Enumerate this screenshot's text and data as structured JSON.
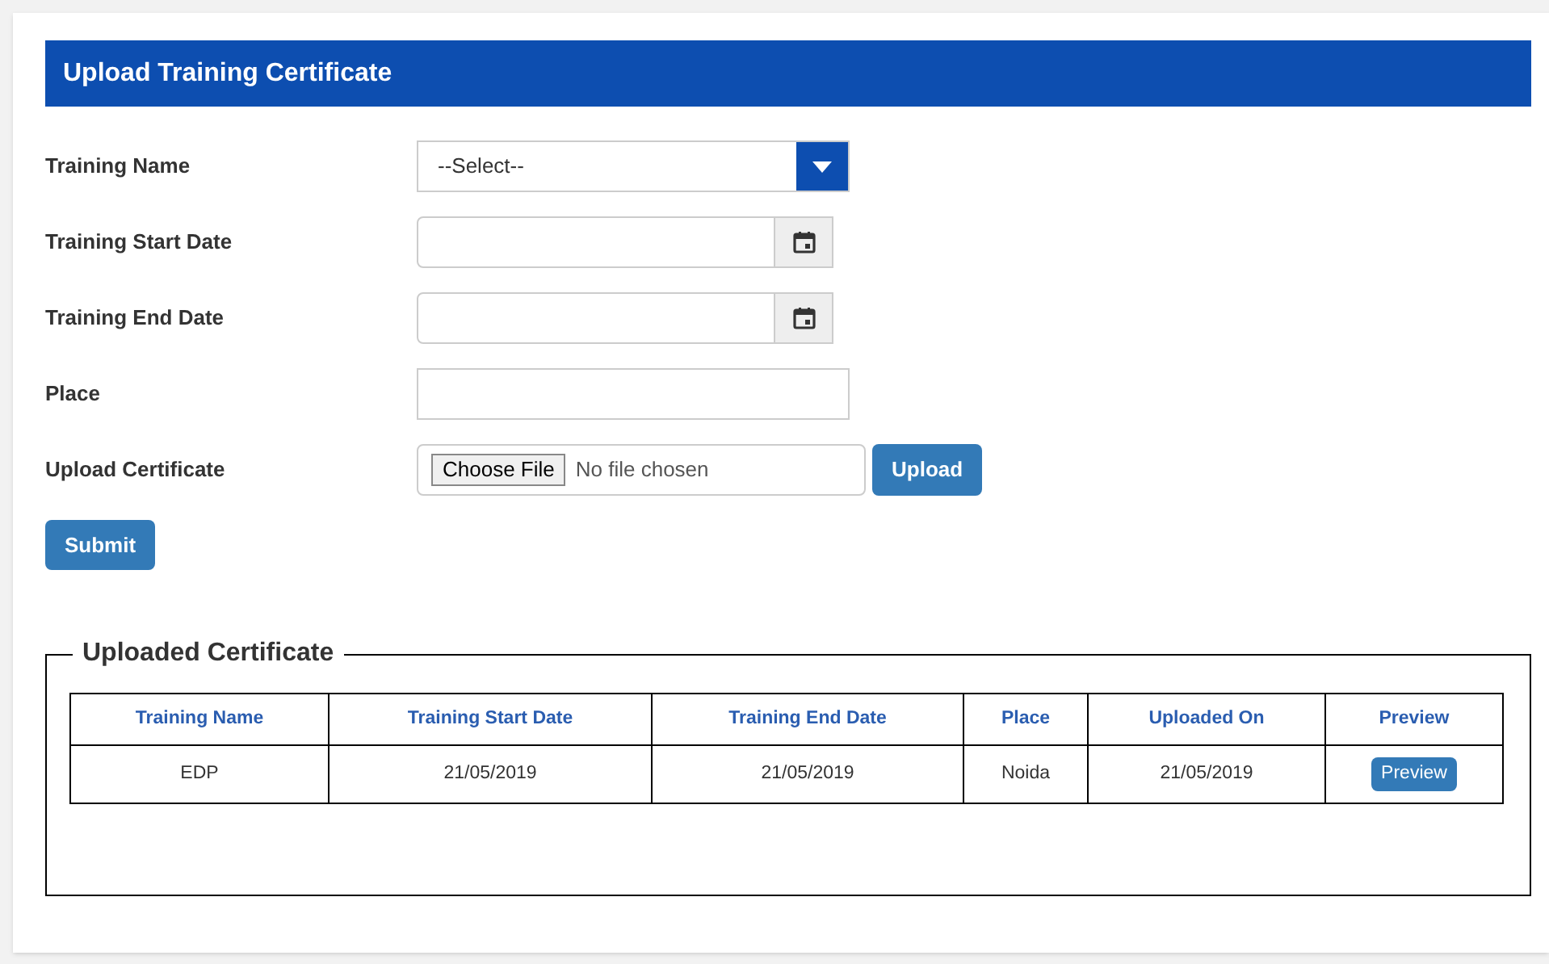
{
  "header": {
    "title": "Upload Training Certificate"
  },
  "fields": [
    {
      "kind": "select",
      "label": "Training Name",
      "value": "--Select--"
    },
    {
      "kind": "date",
      "label": "Training Start Date"
    },
    {
      "kind": "date",
      "label": "Training End Date"
    },
    {
      "kind": "text",
      "label": "Place"
    },
    {
      "kind": "file",
      "label": "Upload Certificate",
      "file_button": "Choose File",
      "file_status": "No file chosen",
      "action": "Upload"
    }
  ],
  "submit": "Submit",
  "uploaded": {
    "title": "Uploaded Certificate",
    "columns": [
      "Training Name",
      "Training Start Date",
      "Training End Date",
      "Place",
      "Uploaded On",
      "Preview"
    ],
    "rows": [
      {
        "cells": [
          "EDP",
          "21/05/2019",
          "21/05/2019",
          "Noida",
          "21/05/2019"
        ],
        "preview": "Preview"
      }
    ]
  }
}
